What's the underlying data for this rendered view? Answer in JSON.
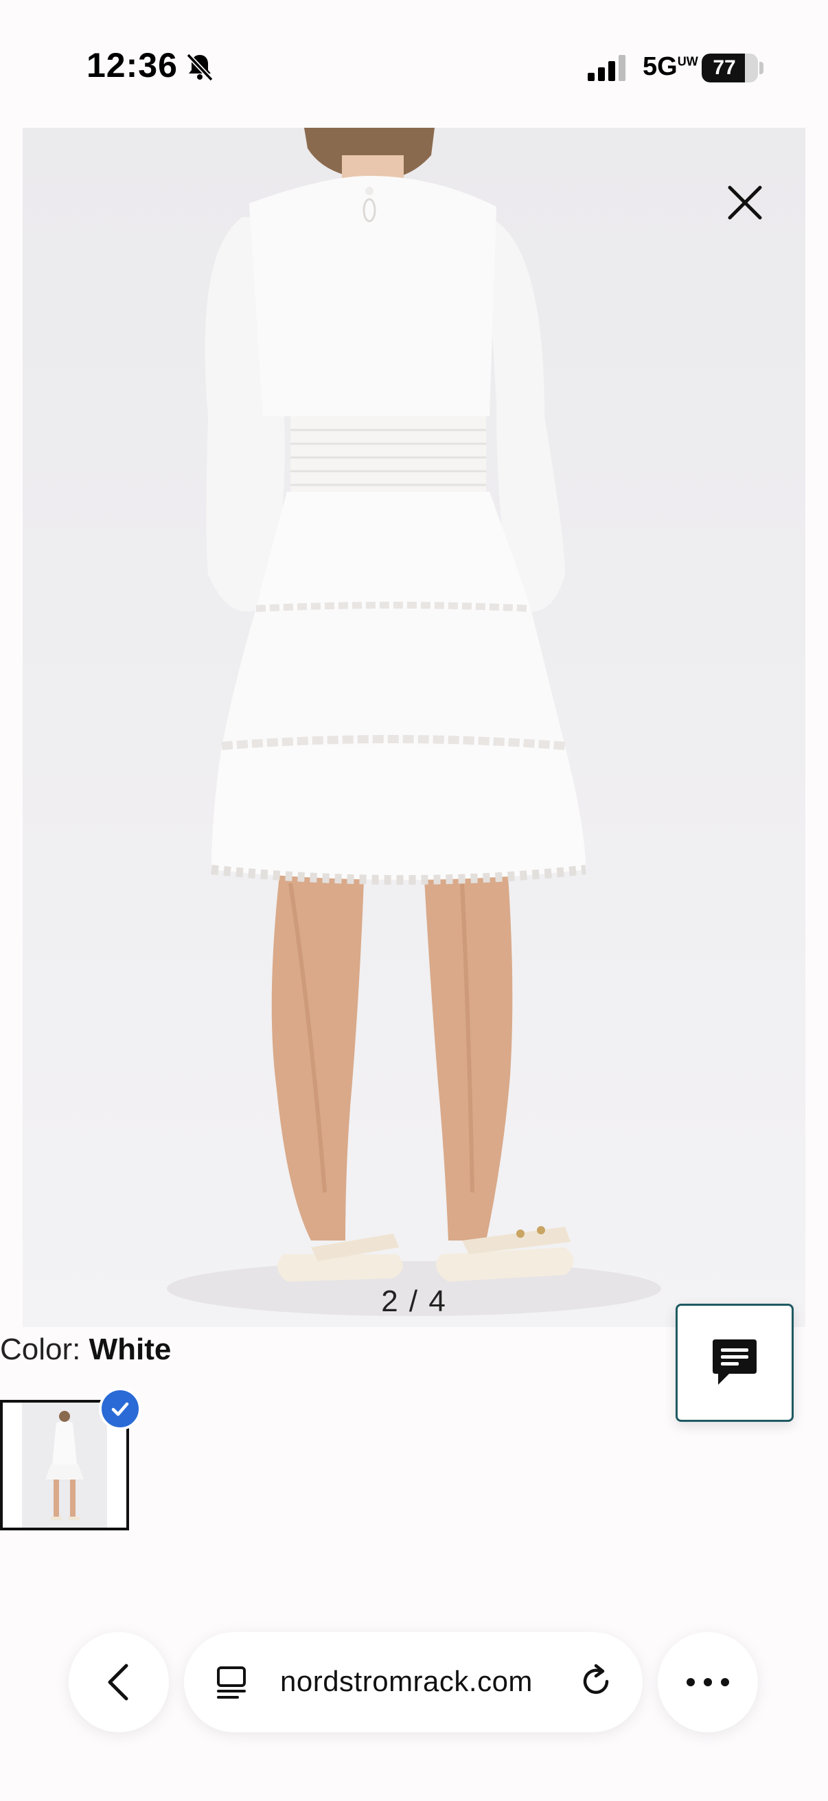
{
  "status_bar": {
    "time": "12:36",
    "network": "5G",
    "network_suffix": "UW",
    "battery_percent": 77
  },
  "gallery": {
    "counter": "2 / 4",
    "close_icon": "close-icon"
  },
  "color": {
    "label": "Color:",
    "value": "White",
    "swatch_selected": true
  },
  "chat": {
    "icon": "chat-bubble-icon"
  },
  "browser": {
    "url": "nordstromrack.com",
    "back_icon": "chevron-left-icon",
    "reader_icon": "reader-mode-icon",
    "reload_icon": "reload-icon",
    "more_icon": "more-dots-icon"
  }
}
